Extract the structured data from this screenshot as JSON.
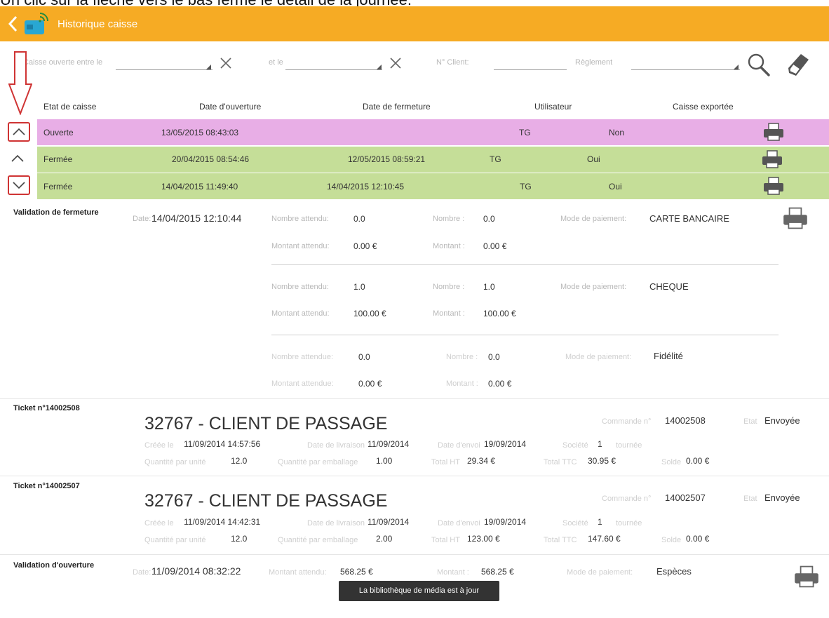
{
  "caption": "Un clic sur la flèche vers le bas ferme le détail de la journée.",
  "appbar": {
    "title": "Historique caisse"
  },
  "filters": {
    "opened_between_label": "Caisse ouverte entre le",
    "and_label": "et le",
    "client_label": "N° Client:",
    "payment_label": "Règlement"
  },
  "columns": [
    "Etat de caisse",
    "Date d'ouverture",
    "Date de fermeture",
    "Utilisateur",
    "Caisse exportée"
  ],
  "rows": [
    {
      "etat": "Ouverte",
      "ouverture": "13/05/2015 08:43:03",
      "fermeture": "",
      "utilisateur": "TG",
      "exportee": "Non",
      "color": "#e8aee6"
    },
    {
      "etat": "Fermée",
      "ouverture": "20/04/2015 08:54:46",
      "fermeture": "12/05/2015 08:59:21",
      "utilisateur": "TG",
      "exportee": "Oui",
      "color": "#c5de98"
    },
    {
      "etat": "Fermée",
      "ouverture": "14/04/2015 11:49:40",
      "fermeture": "14/04/2015 12:10:45",
      "utilisateur": "TG",
      "exportee": "Oui",
      "color": "#c5de98"
    }
  ],
  "closing": {
    "title": "Validation de fermeture",
    "date_label": "Date:",
    "date": "14/04/2015 12:10:44",
    "payments": [
      {
        "expected_count_label": "Nombre attendu:",
        "expected_count": "0.0",
        "count_label": "Nombre :",
        "count": "0.0",
        "mode_label": "Mode de paiement:",
        "mode": "CARTE BANCAIRE",
        "expected_amount_label": "Montant attendu:",
        "expected_amount": "0.00 €",
        "amount_label": "Montant :",
        "amount": "0.00 €"
      },
      {
        "expected_count_label": "Nombre attendu:",
        "expected_count": "1.0",
        "count_label": "Nombre :",
        "count": "1.0",
        "mode_label": "Mode de paiement:",
        "mode": "CHEQUE",
        "expected_amount_label": "Montant attendu:",
        "expected_amount": "100.00 €",
        "amount_label": "Montant :",
        "amount": "100.00 €"
      },
      {
        "expected_count_label": "Nombre attendue:",
        "expected_count": "0.0",
        "count_label": "Nombre :",
        "count": "0.0",
        "mode_label": "Mode de paiement:",
        "mode": "Fidélité",
        "expected_amount_label": "Montant attendue:",
        "expected_amount": "0.00 €",
        "amount_label": "Montant :",
        "amount": "0.00 €"
      }
    ]
  },
  "tickets": [
    {
      "title": "Ticket n°14002508",
      "client": "32767 - CLIENT DE PASSAGE",
      "order_label": "Commande n°",
      "order": "14002508",
      "state_label": "Etat",
      "state": "Envoyée",
      "created_label": "Créée le",
      "created": "11/09/2014 14:57:56",
      "delivery_label": "Date de livraison",
      "delivery": "11/09/2014",
      "sent_label": "Date d'envoi",
      "sent": "19/09/2014",
      "company_label": "Société",
      "company": "1",
      "tour_label": "tournée",
      "qty_unit_label": "Quantité par unité",
      "qty_unit": "12.0",
      "qty_pack_label": "Quantité par emballage",
      "qty_pack": "1.00",
      "total_ht_label": "Total HT",
      "total_ht": "29.34 €",
      "total_ttc_label": "Total TTC",
      "total_ttc": "30.95 €",
      "balance_label": "Solde",
      "balance": "0.00 €"
    },
    {
      "title": "Ticket n°14002507",
      "client": "32767 - CLIENT DE PASSAGE",
      "order_label": "Commande n°",
      "order": "14002507",
      "state_label": "Etat",
      "state": "Envoyée",
      "created_label": "Créée le",
      "created": "11/09/2014 14:42:31",
      "delivery_label": "Date de livraison",
      "delivery": "11/09/2014",
      "sent_label": "Date d'envoi",
      "sent": "19/09/2014",
      "company_label": "Société",
      "company": "1",
      "tour_label": "tournée",
      "qty_unit_label": "Quantité par unité",
      "qty_unit": "12.0",
      "qty_pack_label": "Quantité par emballage",
      "qty_pack": "2.00",
      "total_ht_label": "Total HT",
      "total_ht": "123.00 €",
      "total_ttc_label": "Total TTC",
      "total_ttc": "147.60 €",
      "balance_label": "Solde",
      "balance": "0.00 €"
    }
  ],
  "opening": {
    "title": "Validation d'ouverture",
    "date_label": "Date:",
    "date": "11/09/2014 08:32:22",
    "expected_amount_label": "Montant attendu:",
    "expected_amount": "568.25 €",
    "amount_label": "Montant :",
    "amount": "568.25 €",
    "mode_label": "Mode de paiement:",
    "mode": "Espèces"
  },
  "toast": "La bibliothèque de média est à jour",
  "colors": {
    "appbar": "#f6ab24",
    "open_row": "#e8aee6",
    "closed_row": "#c5de98",
    "annotation": "#cf3434"
  },
  "icons": [
    "back-chevron-icon",
    "card-reader-logo-icon",
    "clear-x-icon",
    "search-icon",
    "eraser-icon",
    "chevron-up-icon",
    "chevron-down-icon",
    "printer-icon",
    "red-down-arrow-icon"
  ]
}
